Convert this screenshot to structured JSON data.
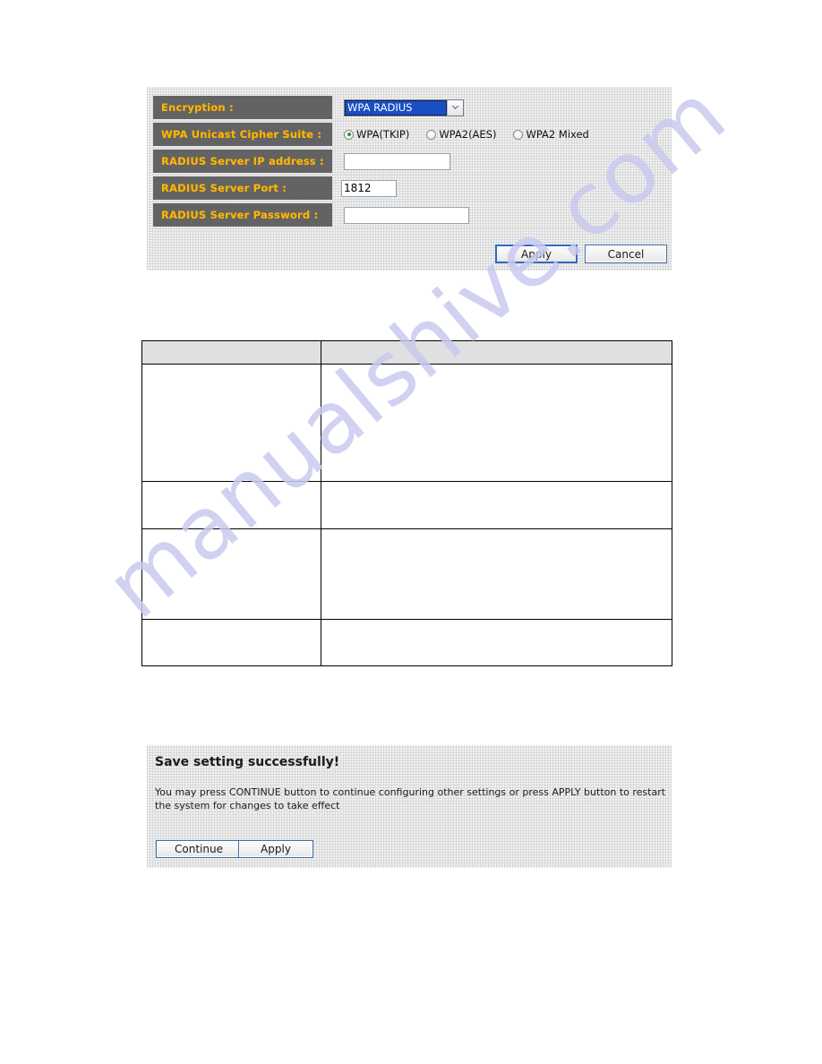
{
  "config_panel": {
    "rows": [
      {
        "label": "Encryption :",
        "type": "select"
      },
      {
        "label": "WPA Unicast Cipher Suite :",
        "type": "radio"
      },
      {
        "label": "RADIUS Server IP address :",
        "type": "text"
      },
      {
        "label": "RADIUS Server Port :",
        "type": "text"
      },
      {
        "label": "RADIUS Server Password :",
        "type": "text"
      }
    ],
    "encryption": {
      "selected": "WPA RADIUS",
      "arrow_icon": "chevron-down-icon"
    },
    "cipher_suite": {
      "options": [
        {
          "label": "WPA(TKIP)",
          "checked": true
        },
        {
          "label": "WPA2(AES)",
          "checked": false
        },
        {
          "label": "WPA2 Mixed",
          "checked": false
        }
      ]
    },
    "radius_server_ip": {
      "value": "",
      "placeholder": ""
    },
    "radius_server_port": {
      "value": "1812",
      "placeholder": ""
    },
    "radius_server_password": {
      "value": "",
      "placeholder": ""
    },
    "apply_label": "Apply",
    "cancel_label": "Cancel"
  },
  "desc_table": {
    "headers": [
      "",
      ""
    ],
    "rows": [
      [
        "",
        ""
      ],
      [
        "",
        ""
      ],
      [
        "",
        ""
      ],
      [
        "",
        ""
      ]
    ]
  },
  "save_panel": {
    "title": "Save setting successfully!",
    "description": "You may press CONTINUE button to continue configuring other settings or press APPLY button to restart the system for changes to take effect",
    "continue_label": "Continue",
    "apply_label": "Apply"
  },
  "watermark": {
    "text": "manualshive.com"
  },
  "colors": {
    "label_bg": "#636363",
    "label_text": "#ffb400",
    "select_highlight": "#1a4fc4",
    "radio_checked": "#1f9a3d",
    "panel_bg": "#f3f3f3",
    "table_header_bg": "#e0e0e0",
    "watermark": "#c9c9ef"
  }
}
